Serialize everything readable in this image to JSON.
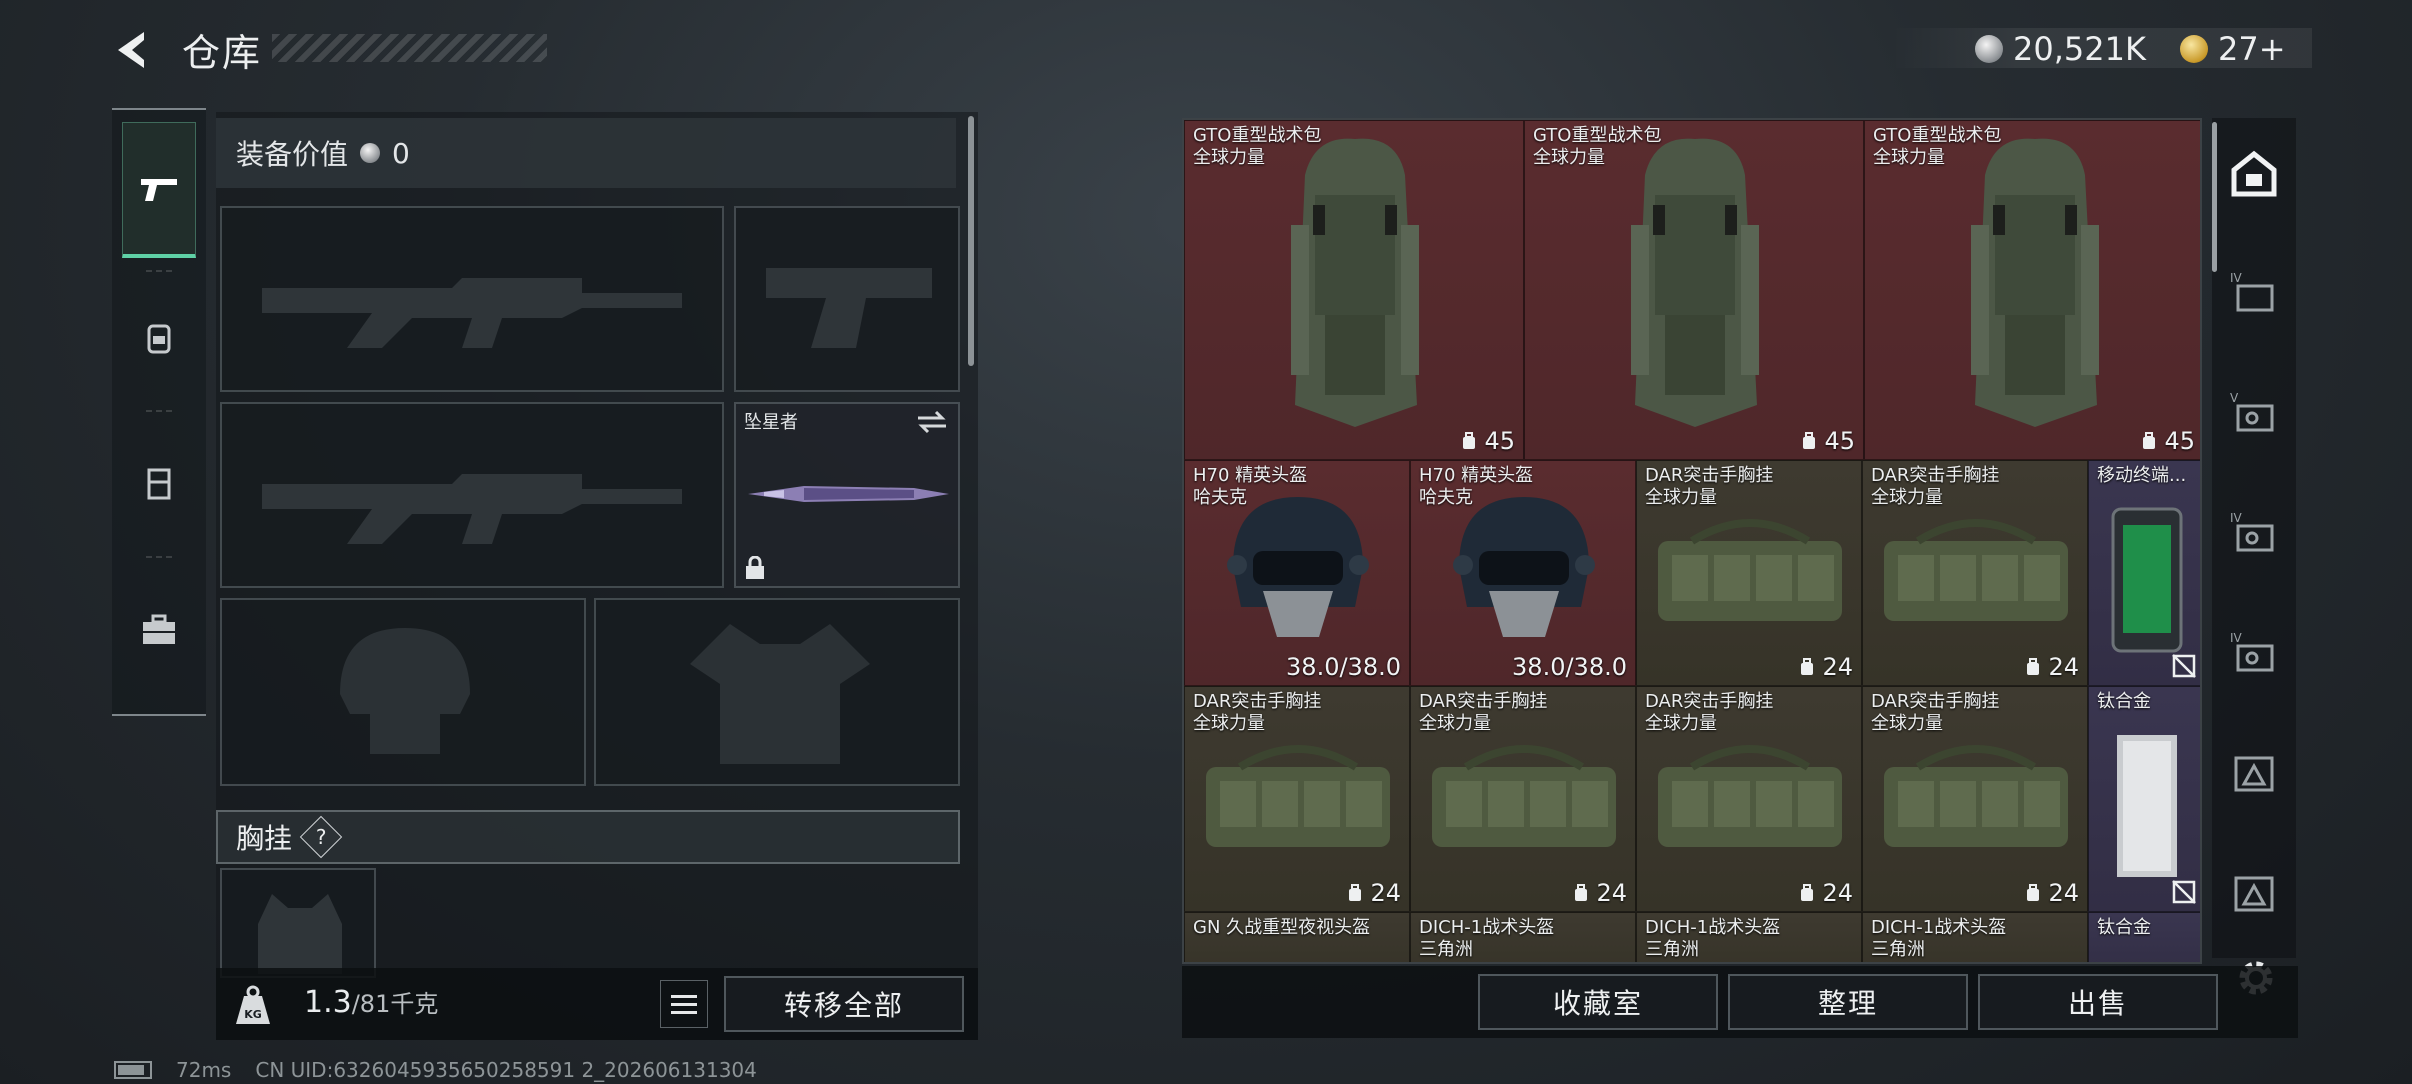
{
  "header": {
    "title": "仓库",
    "currency_primary": "20,521K",
    "currency_secondary": "27+"
  },
  "equipment": {
    "value_label": "装备价值",
    "value": "0",
    "melee_slot_label": "坠星者",
    "chest_rig_label": "胸挂",
    "help_glyph": "?"
  },
  "bottom_left": {
    "weight_current": "1.3",
    "weight_max": "/81千克",
    "transfer_all": "转移全部"
  },
  "status": {
    "ping": "72ms",
    "uid": "CN UID:6326045935650258591 2_202606131304"
  },
  "stash": {
    "items": [
      {
        "name": "GTO重型战术包",
        "sub": "全球力量",
        "count": "45",
        "color": "red",
        "kind": "backpack"
      },
      {
        "name": "GTO重型战术包",
        "sub": "全球力量",
        "count": "45",
        "color": "red",
        "kind": "backpack"
      },
      {
        "name": "GTO重型战术包",
        "sub": "全球力量",
        "count": "45",
        "color": "red",
        "kind": "backpack"
      },
      {
        "name": "H70 精英头盔",
        "sub": "哈夫克",
        "count": "38.0/38.0",
        "color": "red",
        "kind": "helmet"
      },
      {
        "name": "H70 精英头盔",
        "sub": "哈夫克",
        "count": "38.0/38.0",
        "color": "red",
        "kind": "helmet"
      },
      {
        "name": "DAR突击手胸挂",
        "sub": "全球力量",
        "count": "24",
        "color": "olive",
        "kind": "rig"
      },
      {
        "name": "DAR突击手胸挂",
        "sub": "全球力量",
        "count": "24",
        "color": "olive",
        "kind": "rig"
      },
      {
        "name": "移动终端...",
        "sub": "",
        "count": "",
        "color": "purple",
        "kind": "terminal"
      },
      {
        "name": "DAR突击手胸挂",
        "sub": "全球力量",
        "count": "24",
        "color": "olive",
        "kind": "rig"
      },
      {
        "name": "DAR突击手胸挂",
        "sub": "全球力量",
        "count": "24",
        "color": "olive",
        "kind": "rig"
      },
      {
        "name": "DAR突击手胸挂",
        "sub": "全球力量",
        "count": "24",
        "color": "olive",
        "kind": "rig"
      },
      {
        "name": "DAR突击手胸挂",
        "sub": "全球力量",
        "count": "24",
        "color": "olive",
        "kind": "rig"
      },
      {
        "name": "钛合金",
        "sub": "",
        "count": "",
        "color": "purple",
        "kind": "plate"
      },
      {
        "name": "GN 久战重型夜视头盔",
        "sub": "",
        "count": "",
        "color": "olive",
        "kind": "partial"
      },
      {
        "name": "DICH-1战术头盔",
        "sub": "三角洲",
        "count": "",
        "color": "olive",
        "kind": "partial"
      },
      {
        "name": "DICH-1战术头盔",
        "sub": "三角洲",
        "count": "",
        "color": "olive",
        "kind": "partial"
      },
      {
        "name": "DICH-1战术头盔",
        "sub": "三角洲",
        "count": "",
        "color": "olive",
        "kind": "partial"
      },
      {
        "name": "钛合金",
        "sub": "",
        "count": "",
        "color": "purple",
        "kind": "partial"
      }
    ]
  },
  "actions": {
    "collection": "收藏室",
    "sort": "整理",
    "sell": "出售"
  },
  "categories": [
    "home-safe-icon",
    "iv-card-icon",
    "v-key-icon",
    "iv-key-icon",
    "iv-key-icon-2",
    "warning-card-icon",
    "warning-card-icon-2"
  ],
  "colors": {
    "accent_green": "#5fd1a6",
    "cell_red": "#5a2c2f",
    "cell_olive": "#3e3a30",
    "cell_purple": "#3a3650"
  }
}
